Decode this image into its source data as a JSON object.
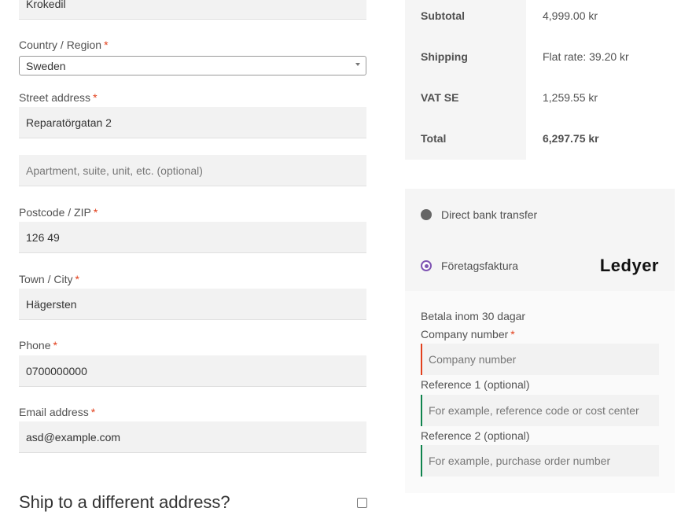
{
  "billing": {
    "company_value": "Krokedil",
    "country_label": "Country / Region",
    "country_value": "Sweden",
    "street_label": "Street address",
    "street_value": "Reparatörgatan 2",
    "apartment_placeholder": "Apartment, suite, unit, etc. (optional)",
    "postcode_label": "Postcode / ZIP",
    "postcode_value": "126 49",
    "city_label": "Town / City",
    "city_value": "Hägersten",
    "phone_label": "Phone",
    "phone_value": "0700000000",
    "email_label": "Email address",
    "email_value": "asd@example.com",
    "required_mark": "*"
  },
  "shipping": {
    "heading": "Ship to a different address?",
    "checked": false
  },
  "totals": {
    "subtotal_label": "Subtotal",
    "subtotal_value": "4,999.00 kr",
    "shipping_label": "Shipping",
    "shipping_value": "Flat rate: 39.20 kr",
    "vat_label": "VAT SE",
    "vat_value": "1,259.55 kr",
    "total_label": "Total",
    "total_value": "6,297.75 kr"
  },
  "payment": {
    "method_bank": "Direct bank transfer",
    "method_invoice": "Företagsfaktura",
    "logo_text": "Ledyer",
    "description": "Betala inom 30 dagar",
    "company_number_label": "Company number",
    "company_number_placeholder": "Company number",
    "ref1_label": "Reference 1 (optional)",
    "ref1_placeholder": "For example, reference code or cost center",
    "ref2_label": "Reference 2 (optional)",
    "ref2_placeholder": "For example, purchase order number",
    "accent_color": "#7f54b3",
    "error_color": "#e2401c",
    "valid_color": "#0f834d"
  }
}
